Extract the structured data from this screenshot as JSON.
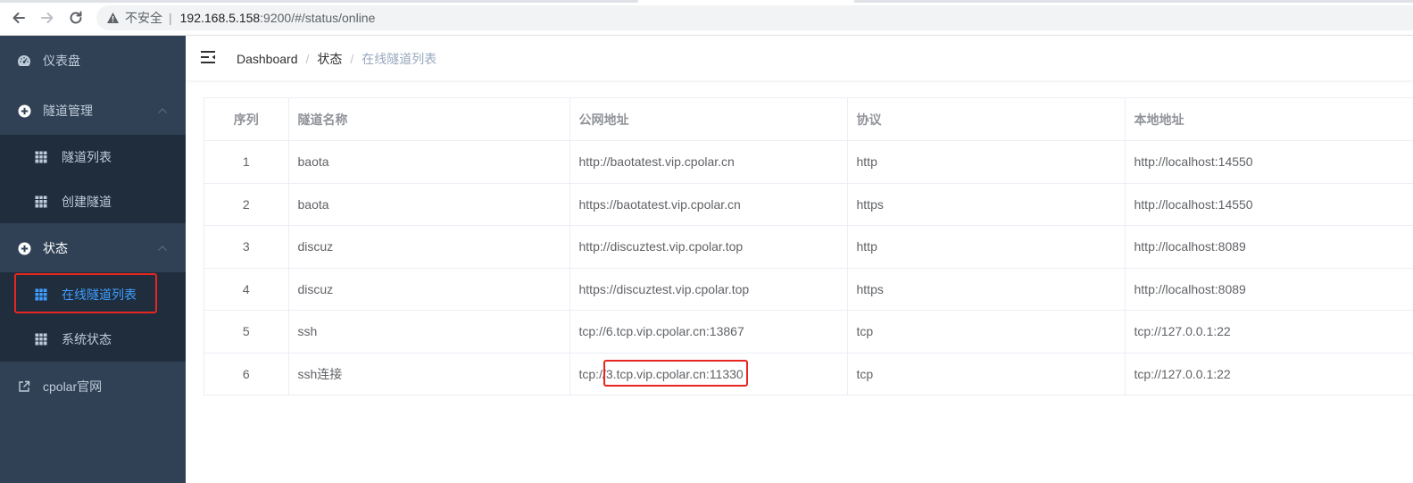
{
  "browser": {
    "insecure_label": "不安全",
    "url_host": "192.168.5.158",
    "url_path": ":9200/#/status/online"
  },
  "sidebar": {
    "items": [
      {
        "label": "仪表盘",
        "icon": "dashboard-icon"
      },
      {
        "label": "隧道管理",
        "icon": "plus-circle-icon",
        "expanded": true
      },
      {
        "label": "状态",
        "icon": "plus-circle-icon",
        "expanded": true
      },
      {
        "label": "cpolar官网",
        "icon": "external-link-icon"
      }
    ],
    "tunnel_sub": [
      {
        "label": "隧道列表",
        "icon": "grid-icon"
      },
      {
        "label": "创建隧道",
        "icon": "grid-icon"
      }
    ],
    "status_sub": [
      {
        "label": "在线隧道列表",
        "icon": "grid-icon",
        "active": true
      },
      {
        "label": "系统状态",
        "icon": "grid-icon"
      }
    ]
  },
  "breadcrumb": {
    "items": [
      "Dashboard",
      "状态",
      "在线隧道列表"
    ]
  },
  "table": {
    "headers": [
      "序列",
      "隧道名称",
      "公网地址",
      "协议",
      "本地地址"
    ],
    "rows": [
      [
        "1",
        "baota",
        "http://baotatest.vip.cpolar.cn",
        "http",
        "http://localhost:14550"
      ],
      [
        "2",
        "baota",
        "https://baotatest.vip.cpolar.cn",
        "https",
        "http://localhost:14550"
      ],
      [
        "3",
        "discuz",
        "http://discuztest.vip.cpolar.top",
        "http",
        "http://localhost:8089"
      ],
      [
        "4",
        "discuz",
        "https://discuztest.vip.cpolar.top",
        "https",
        "http://localhost:8089"
      ],
      [
        "5",
        "ssh",
        "tcp://6.tcp.vip.cpolar.cn:13867",
        "tcp",
        "tcp://127.0.0.1:22"
      ],
      [
        "6",
        "ssh连接",
        "tcp://3.tcp.vip.cpolar.cn:11330",
        "tcp",
        "tcp://127.0.0.1:22"
      ]
    ]
  },
  "colors": {
    "sidebar_bg": "#304156",
    "submenu_bg": "#1f2d3d",
    "active_blue": "#409eff",
    "highlight_red": "#e8261f"
  }
}
